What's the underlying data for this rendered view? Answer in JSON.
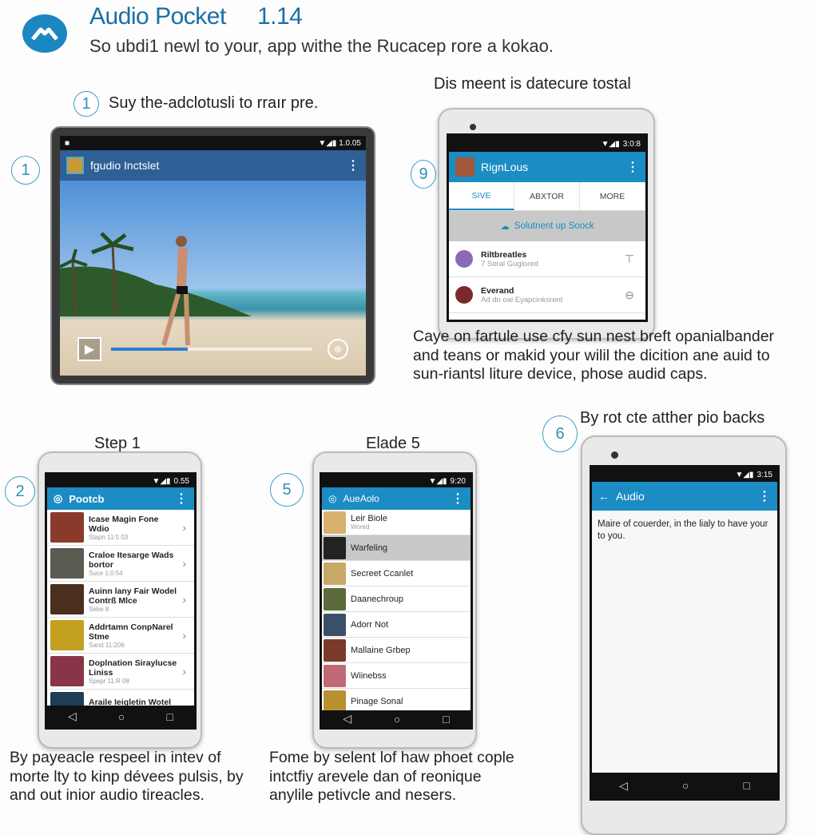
{
  "header": {
    "title": "Audio Pocket     1.14",
    "subtitle": "So ubdi1 newl to your, app withe the Rucacep rore a kokao.",
    "logo_icon": "mountain-logo-icon"
  },
  "colors": {
    "accent": "#1a87c0",
    "appbar_blue": "#1b8cc4",
    "tablet_appbar": "#2e5f95"
  },
  "step1": {
    "number": "1",
    "text": "Suy the-adclotusli to rraır pre.",
    "side_number": "1"
  },
  "tablet": {
    "status_time": "1.0.05",
    "app_title": "fgudio Inctslet",
    "progress": 0.38
  },
  "phone2": {
    "heading": "Dis meent is datecure tostal",
    "side_number": "9",
    "status_time": "3:0:8",
    "app_title": "RignLous",
    "tabs": [
      "SIVE",
      "ABXTOR",
      "MORE"
    ],
    "active_tab": 0,
    "banner": "Solutnent up Soock",
    "items": [
      {
        "title": "Riltbreatles",
        "sub": "7 Soral Guglored"
      },
      {
        "title": "Everand",
        "sub": "Ad dn oal Eyapcinksrent"
      }
    ]
  },
  "paragraph_right": [
    "Caye on fartule use cfy sun nest breft opanialbander",
    "and teans or makid your wilil the dicition ane auid to",
    "sun-riantsl liture device, phose audid caps."
  ],
  "phone3": {
    "caption": "Step 1",
    "side_number": "2",
    "status_time": "0.55",
    "app_title": "Pootcb",
    "items": [
      {
        "title": "Icase Magin Fone Wdio",
        "sub": "Stapn 11:5 03",
        "color": "#8a3a2a"
      },
      {
        "title": "Craloe Itesarge Wads bortor",
        "sub": "Suce 1:0:54",
        "color": "#5a5a50"
      },
      {
        "title": "Auinn lany Fair Wodel Contrß Mlce",
        "sub": "Sebe 8",
        "color": "#4a2e1e"
      },
      {
        "title": "Addrtamn ConpNarel Stme",
        "sub": "Sand 11:206",
        "color": "#c4a020"
      },
      {
        "title": "Doplnation Siraylucse Liniss",
        "sub": "Spepr 11:R 08",
        "color": "#8a3448"
      },
      {
        "title": "Araile Ieigletin Wotel Pepultrol",
        "sub": "",
        "color": "#1e3e58"
      }
    ]
  },
  "phone4": {
    "caption": "Elade 5",
    "side_number": "5",
    "status_time": "9:20",
    "app_title": "AueAolo",
    "selected_index": 1,
    "items": [
      {
        "title": "Leir Biole",
        "sub": "Wored",
        "color": "#d8b070"
      },
      {
        "title": "Warfeling",
        "sub": "",
        "color": "#222"
      },
      {
        "title": "Secreet Ccanlet",
        "sub": "",
        "color": "#c8a868"
      },
      {
        "title": "Daanechroup",
        "sub": "",
        "color": "#5a6a3a"
      },
      {
        "title": "Adorr Not",
        "sub": "",
        "color": "#3a5068"
      },
      {
        "title": "Mallaine Grbep",
        "sub": "",
        "color": "#7a3a2a"
      },
      {
        "title": "Wiinebss",
        "sub": "",
        "color": "#c06a78"
      },
      {
        "title": "Pinage Sonal",
        "sub": "",
        "color": "#b89030"
      }
    ]
  },
  "phone5": {
    "heading": "By rot cte atther pio backs",
    "side_number": "6",
    "status_time": "3:15",
    "app_title": "Audio",
    "body": "Maire of couerder, in the lialy to have your to you."
  },
  "paragraph_left": [
    "By payeacle respeel in intev of",
    "morte lty to kinp dévees pulsis, by",
    "and out inior audio tireacles."
  ],
  "paragraph_mid": [
    "Fome by selent lof haw phoet cople",
    "intctfiy arevele dan of reonique",
    "anylile petivcle and nesers."
  ],
  "nav": {
    "back": "◁",
    "home": "○",
    "recent": "□"
  }
}
